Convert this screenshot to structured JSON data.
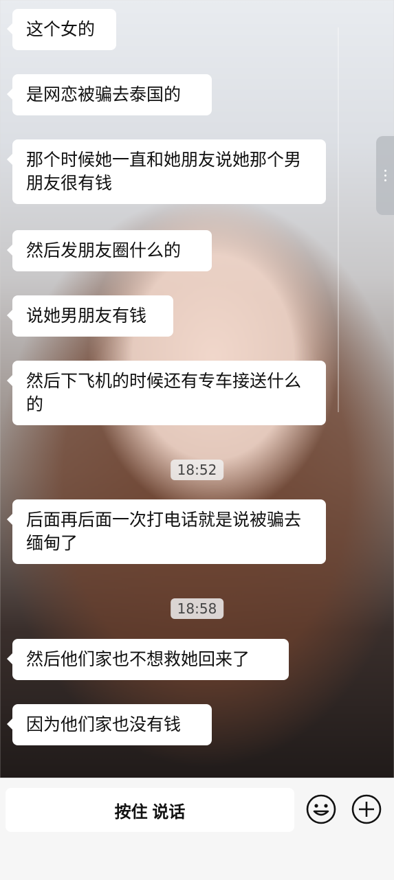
{
  "messages": [
    {
      "text": "这个女的"
    },
    {
      "text": "是网恋被骗去泰国的"
    },
    {
      "text": "那个时候她一直和她朋友说她那个男朋友很有钱"
    },
    {
      "text": "然后发朋友圈什么的"
    },
    {
      "text": "说她男朋友有钱"
    },
    {
      "text": "然后下飞机的时候还有专车接送什么的"
    },
    {
      "text": "后面再后面一次打电话就是说被骗去缅甸了"
    },
    {
      "text": "然后他们家也不想救她回来了"
    },
    {
      "text": "因为他们家也没有钱"
    }
  ],
  "timestamps": [
    "18:52",
    "18:58"
  ],
  "bottom_bar": {
    "voice_label": "按住 说话",
    "emoji_icon": "smiley-face-icon",
    "add_icon": "plus-circle-icon"
  },
  "colors": {
    "bubble": "#ffffff",
    "bottom_bar": "#f6f6f6"
  }
}
